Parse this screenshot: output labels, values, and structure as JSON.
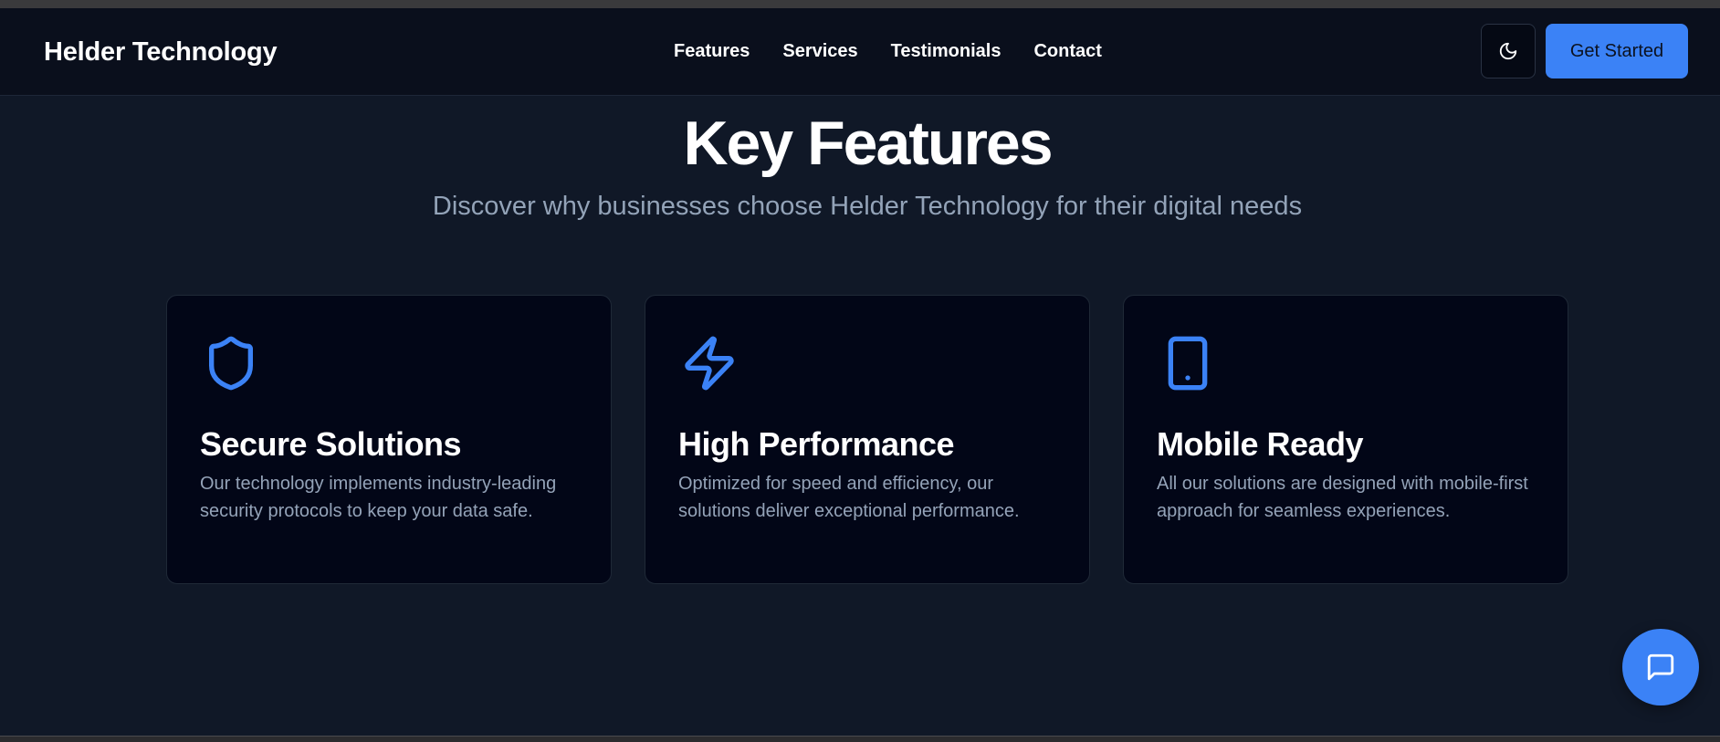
{
  "header": {
    "brand": "Helder Technology",
    "nav": [
      "Features",
      "Services",
      "Testimonials",
      "Contact"
    ],
    "theme_toggle_icon": "moon-icon",
    "cta_label": "Get Started"
  },
  "features": {
    "title": "Key Features",
    "subtitle": "Discover why businesses choose Helder Technology for their digital needs",
    "cards": [
      {
        "icon": "shield-icon",
        "title": "Secure Solutions",
        "description": "Our technology implements industry-leading security protocols to keep your data safe."
      },
      {
        "icon": "lightning-icon",
        "title": "High Performance",
        "description": "Optimized for speed and efficiency, our solutions deliver exceptional performance."
      },
      {
        "icon": "smartphone-icon",
        "title": "Mobile Ready",
        "description": "All our solutions are designed with mobile-first approach for seamless experiences."
      }
    ]
  },
  "chat": {
    "icon": "message-square-icon"
  },
  "colors": {
    "accent": "#3b82f6",
    "background": "#101827",
    "card": "#020617",
    "muted_text": "#94a3b8"
  }
}
